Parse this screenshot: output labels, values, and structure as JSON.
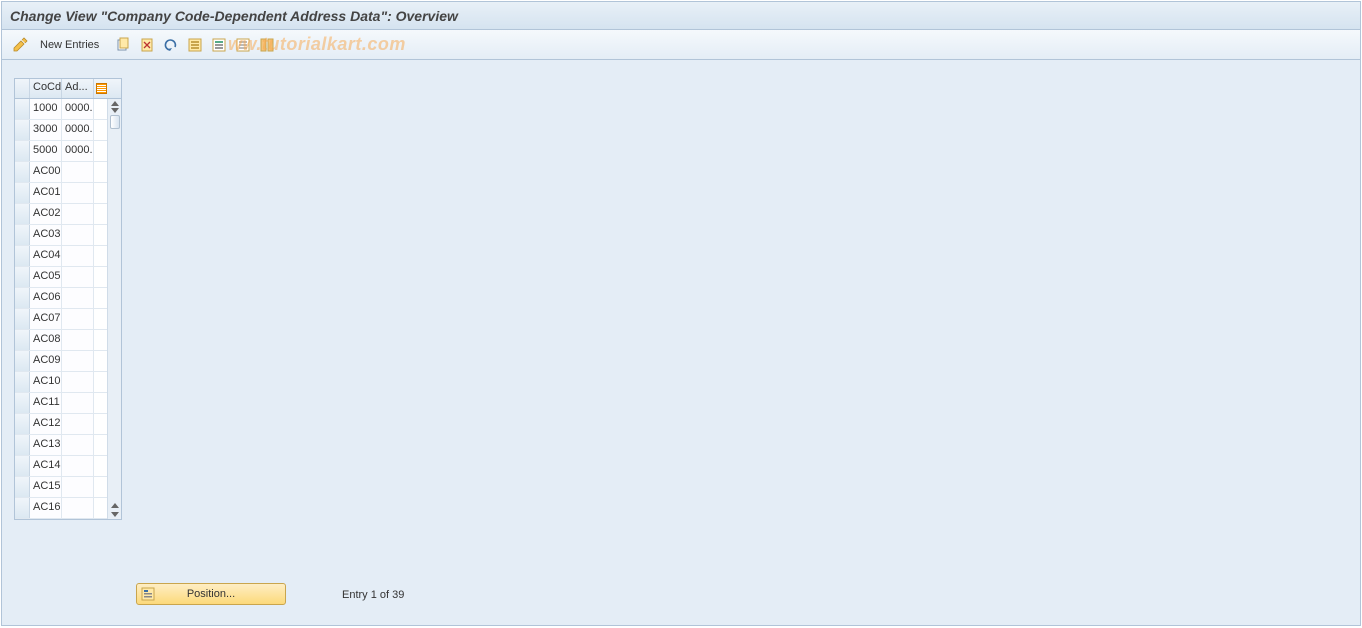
{
  "header": {
    "title": "Change View \"Company Code-Dependent Address Data\": Overview"
  },
  "toolbar": {
    "new_entries_label": "New Entries",
    "icons": {
      "edit": "edit-pencil-icon",
      "copy": "copy-icon",
      "delete": "delete-icon",
      "undo": "undo-icon",
      "select_all": "select-all-icon",
      "select_block": "select-block-icon",
      "deselect_all": "deselect-all-icon",
      "table_settings": "table-settings-icon"
    }
  },
  "watermark": "ww.tutorialkart.com",
  "table": {
    "columns": {
      "col1": "CoCd",
      "col2": "Ad..."
    },
    "rows": [
      {
        "cocd": "1000",
        "addr": "0000."
      },
      {
        "cocd": "3000",
        "addr": "0000."
      },
      {
        "cocd": "5000",
        "addr": "0000."
      },
      {
        "cocd": "AC00",
        "addr": ""
      },
      {
        "cocd": "AC01",
        "addr": ""
      },
      {
        "cocd": "AC02",
        "addr": ""
      },
      {
        "cocd": "AC03",
        "addr": ""
      },
      {
        "cocd": "AC04",
        "addr": ""
      },
      {
        "cocd": "AC05",
        "addr": ""
      },
      {
        "cocd": "AC06",
        "addr": ""
      },
      {
        "cocd": "AC07",
        "addr": ""
      },
      {
        "cocd": "AC08",
        "addr": ""
      },
      {
        "cocd": "AC09",
        "addr": ""
      },
      {
        "cocd": "AC10",
        "addr": ""
      },
      {
        "cocd": "AC11",
        "addr": ""
      },
      {
        "cocd": "AC12",
        "addr": ""
      },
      {
        "cocd": "AC13",
        "addr": ""
      },
      {
        "cocd": "AC14",
        "addr": ""
      },
      {
        "cocd": "AC15",
        "addr": ""
      },
      {
        "cocd": "AC16",
        "addr": ""
      }
    ]
  },
  "footer": {
    "position_label": "Position...",
    "entry_status": "Entry 1 of 39"
  }
}
